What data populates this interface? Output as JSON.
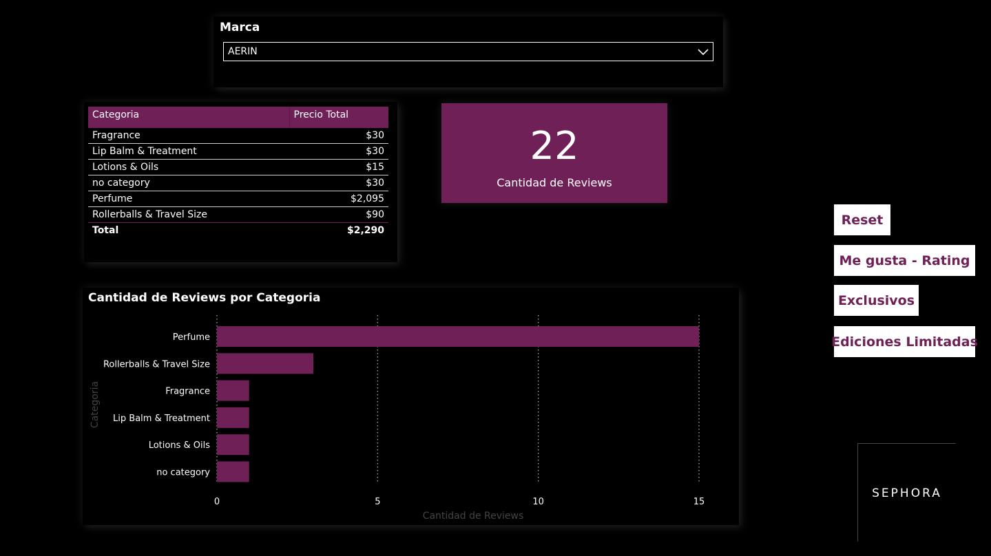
{
  "slicer": {
    "title": "Marca",
    "selected": "AERIN"
  },
  "table": {
    "headers": [
      "Categoria",
      "Precio Total"
    ],
    "rows": [
      [
        "Fragrance",
        "$30"
      ],
      [
        "Lip Balm & Treatment",
        "$30"
      ],
      [
        "Lotions & Oils",
        "$15"
      ],
      [
        "no category",
        "$30"
      ],
      [
        "Perfume",
        "$2,095"
      ],
      [
        "Rollerballs & Travel Size",
        "$90"
      ]
    ],
    "total_label": "Total",
    "total_value": "$2,290"
  },
  "kpi": {
    "value": "22",
    "label": "Cantidad de Reviews"
  },
  "chart_data": {
    "type": "bar",
    "orientation": "horizontal",
    "title": "Cantidad de Reviews por Categoria",
    "categories": [
      "Perfume",
      "Rollerballs & Travel Size",
      "Fragrance",
      "Lip Balm & Treatment",
      "Lotions & Oils",
      "no category"
    ],
    "values": [
      15,
      3,
      1,
      1,
      1,
      1
    ],
    "xlabel": "Cantidad de Reviews",
    "ylabel": "Categoria",
    "xlim": [
      0,
      15
    ],
    "xticks": [
      0,
      5,
      10,
      15
    ],
    "grid": "vertical dotted",
    "bar_color": "#6f2157"
  },
  "buttons": {
    "reset": "Reset",
    "rating": "Me gusta - Rating",
    "exclusivos": "Exclusivos",
    "ediciones": "Ediciones Limitadas"
  },
  "logo": {
    "text": "SEPHORA"
  },
  "colors": {
    "accent": "#6f2157",
    "background": "#000000"
  }
}
